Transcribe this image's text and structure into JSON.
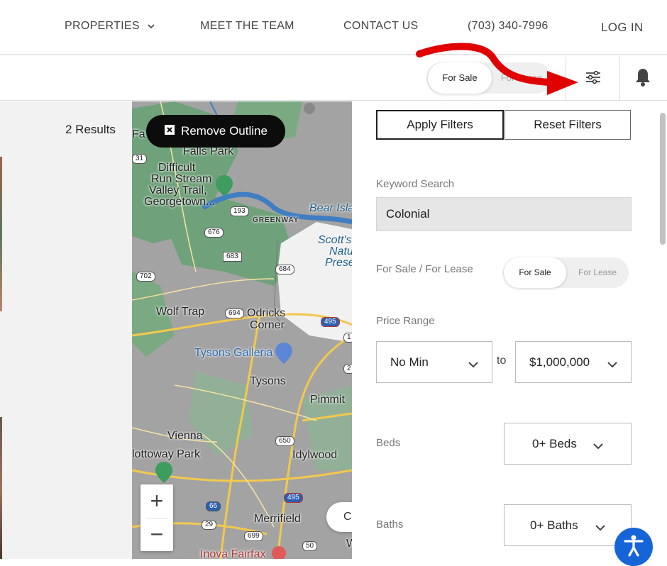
{
  "nav": {
    "properties": "PROPERTIES",
    "meet_team": "MEET THE TEAM",
    "contact": "CONTACT US",
    "phone": "(703) 340-7996",
    "login": "LOG IN"
  },
  "subbar": {
    "toggle_on": "For Sale",
    "toggle_off": "For Lease",
    "filter_icon": "sliders-icon",
    "bell_icon": "bell-icon"
  },
  "results": {
    "count": "2 Results"
  },
  "map": {
    "remove_outline": "Remove Outline",
    "zoom_in": "+",
    "zoom_out": "−",
    "pill_text": "C",
    "labels": {
      "falls_park": "Falls Park",
      "difficult_run": "Difficult\nRun Stream\nValley Trail,\nGeorgetown...",
      "difficult": "Difficult",
      "run_stream": "Run Stream",
      "valley_trail": "Valley Trail,",
      "georgetown": "Georgetown...",
      "greenway": "GREENWAY",
      "bear_island": "Bear Isla",
      "scotts": "Scott's",
      "natu": "Natu",
      "prese": "Prese",
      "wolf_trap": "Wolf Trap",
      "odricks": "Odricks",
      "corner": "Corner",
      "tysons_galleria": "Tysons Galleria",
      "tysons": "Tysons",
      "pimmit": "Pimmit",
      "vienna": "Vienna",
      "idylwood": "Idylwood",
      "nottoway": "lottoway Park",
      "merrifield": "Merrifield",
      "inova": "Inova Fairfax",
      "fa": "Fa",
      "w": "W"
    },
    "shields": {
      "r193": "193",
      "r676": "676",
      "r683": "683",
      "r684": "684",
      "r702": "702",
      "r694": "694",
      "r495a": "495",
      "r650": "650",
      "r495b": "495",
      "r66": "66",
      "r29": "29",
      "r699": "699",
      "r50": "50",
      "r31": "31",
      "r1": "1",
      "r2": "2"
    }
  },
  "filters": {
    "apply": "Apply Filters",
    "reset": "Reset Filters",
    "keyword_label": "Keyword Search",
    "keyword_value": "Colonial",
    "sale_lease_label": "For Sale / For Lease",
    "toggle_on": "For Sale",
    "toggle_off": "For Lease",
    "price_label": "Price Range",
    "price_min": "No Min",
    "price_to": "to",
    "price_max": "$1,000,000",
    "beds_label": "Beds",
    "beds_value": "0+ Beds",
    "baths_label": "Baths",
    "baths_value": "0+ Baths"
  },
  "colors": {
    "accent_red": "#e00000",
    "map_green": "#6fa27a",
    "road_yellow": "#f2c94c",
    "water_blue": "#3f7ec1",
    "a11y_blue": "#1565d8"
  }
}
